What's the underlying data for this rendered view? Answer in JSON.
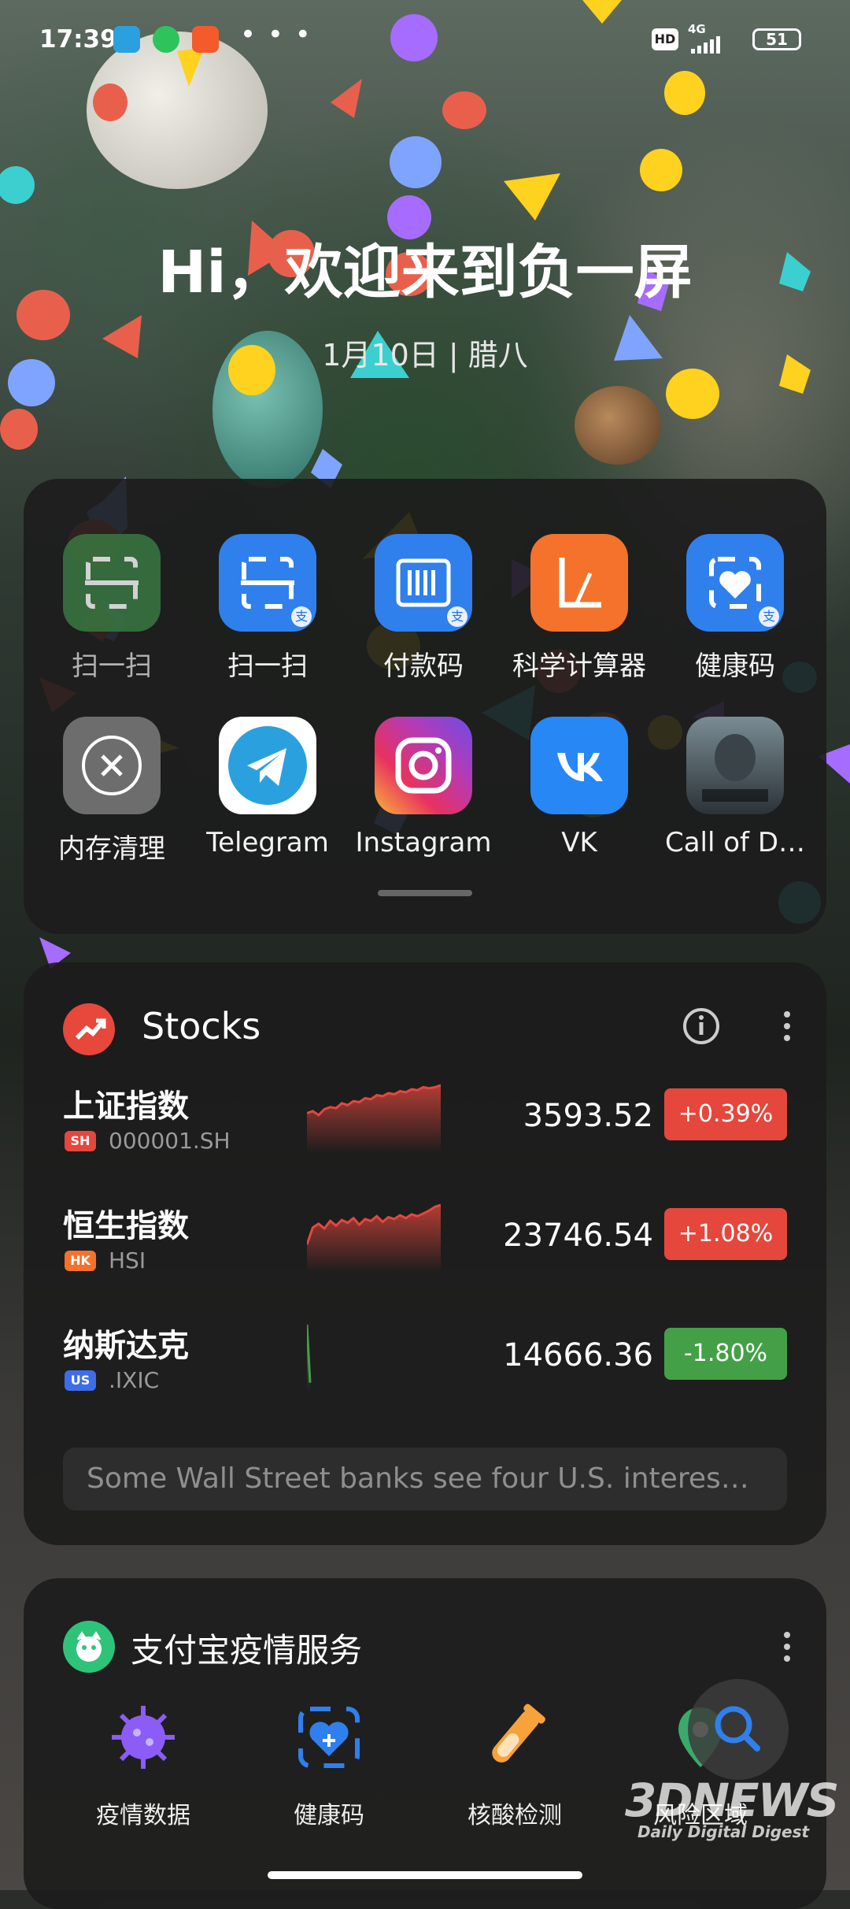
{
  "status": {
    "time": "17:39",
    "more_dots": "• • •",
    "hd": "HD",
    "network": "4G",
    "battery": "51"
  },
  "greeting": {
    "title": "Hi，欢迎来到负一屏",
    "date": "1月10日 | 腊八"
  },
  "apps": [
    {
      "label": "扫一扫",
      "icon": "scan-icon",
      "color": "#3a7d44"
    },
    {
      "label": "扫一扫",
      "icon": "scan-icon",
      "color": "#2f80ed"
    },
    {
      "label": "付款码",
      "icon": "barcode-icon",
      "color": "#2f80ed"
    },
    {
      "label": "科学计算器",
      "icon": "calculator-icon",
      "color": "#f4722b"
    },
    {
      "label": "健康码",
      "icon": "health-code-icon",
      "color": "#2f80ed"
    },
    {
      "label": "内存清理",
      "icon": "memory-clean-icon",
      "color": "#6d6d6d"
    },
    {
      "label": "Telegram",
      "icon": "telegram-icon",
      "color": "#ffffff"
    },
    {
      "label": "Instagram",
      "icon": "instagram-icon",
      "color": "#d62976"
    },
    {
      "label": "VK",
      "icon": "vk-icon",
      "color": "#2787f5"
    },
    {
      "label": "Call of D…",
      "icon": "call-of-duty-icon",
      "color": "#3f4a4f"
    }
  ],
  "stocks": {
    "title": "Stocks",
    "rows": [
      {
        "name": "上证指数",
        "tag": "SH",
        "code": "000001.SH",
        "price": "3593.52",
        "change": "+0.39%",
        "up": true,
        "spark": [
          40,
          42,
          38,
          44,
          46,
          45,
          50,
          48,
          52,
          51,
          55,
          54,
          58,
          57,
          60,
          59,
          62,
          61,
          64,
          63,
          66,
          65,
          66,
          68
        ]
      },
      {
        "name": "恒生指数",
        "tag": "HK",
        "code": "HSI",
        "price": "23746.54",
        "change": "+1.08%",
        "up": true,
        "spark": [
          30,
          48,
          52,
          47,
          55,
          50,
          56,
          53,
          58,
          51,
          57,
          55,
          60,
          54,
          59,
          57,
          61,
          58,
          62,
          60,
          63,
          66,
          70,
          72
        ]
      },
      {
        "name": "纳斯达克",
        "tag": "US",
        "code": ".IXIC",
        "price": "14666.36",
        "change": "-1.80%",
        "up": false,
        "spark": [
          70,
          10
        ]
      }
    ],
    "news": "Some Wall Street banks see four U.S. interes…"
  },
  "alipay": {
    "title": "支付宝疫情服务",
    "tiles": [
      {
        "label": "疫情数据",
        "icon": "virus-icon"
      },
      {
        "label": "健康码",
        "icon": "health-code-icon"
      },
      {
        "label": "核酸检测",
        "icon": "test-tube-icon"
      },
      {
        "label": "风险区域",
        "icon": "risk-area-icon"
      }
    ]
  },
  "watermark": {
    "brand": "3DNEWS",
    "sub": "Daily Digital Digest"
  },
  "colors": {
    "up": "#e5473c",
    "down": "#43a047",
    "tag_sh": "#e5473c",
    "tag_hk": "#f4722b",
    "tag_us": "#3d6ee8"
  }
}
